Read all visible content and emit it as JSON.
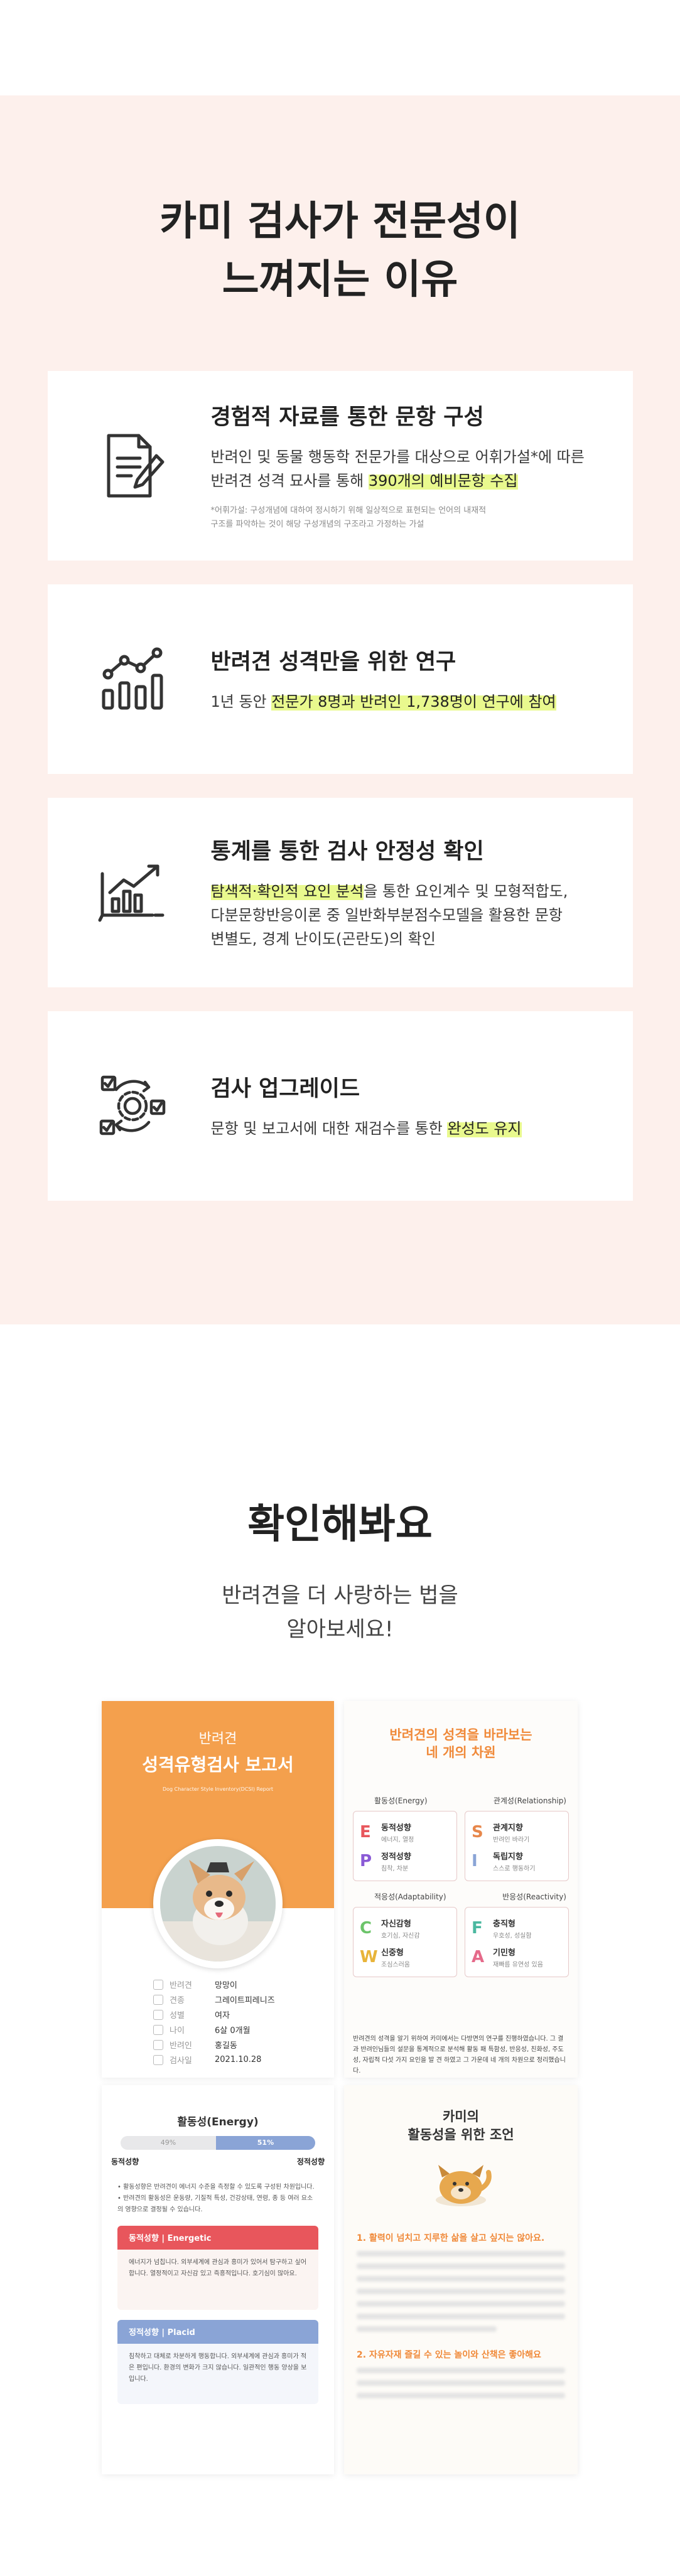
{
  "why": {
    "title_line1": "카미 검사가 전문성이",
    "title_line2": "느껴지는 이유",
    "cards": [
      {
        "icon": "document-pen-icon",
        "title": "경험적 자료를 통한 문항 구성",
        "desc_line1": "반려인 및 동물 행동학 전문가를 대상으로 어휘가설*에 따른",
        "desc_line2_pre": "반려견 성격 묘사를 통해 ",
        "desc_line2_hl": "390개의 예비문항 수집",
        "note_line1": "*어휘가설: 구성개념에 대하여 정시하기 위해 일상적으로 표현되는 언어의 내재적",
        "note_line2": "구조를 파악하는 것이 해당 구성개념의 구조라고 가정하는 가설"
      },
      {
        "icon": "chart-research-icon",
        "title": "반려견 성격만을 위한 연구",
        "desc_pre": "1년 동안 ",
        "desc_hl": "전문가 8명과 반려인 1,738명이 연구에 참여"
      },
      {
        "icon": "statistics-screen-icon",
        "title": "통계를 통한 검사 안정성 확인",
        "desc_hl": "탐색적·확인적 요인 분석",
        "desc_line1_post": "을 통한 요인계수 및 모형적합도,",
        "desc_line2": "다분문항반응이론 중 일반화부분점수모델을 활용한 문항",
        "desc_line3": "변별도, 경계 난이도(곤란도)의 확인"
      },
      {
        "icon": "upgrade-gear-icon",
        "title": "검사 업그레이드",
        "desc_pre": "문항 및 보고서에 대한 재검수를 통한 ",
        "desc_hl": "완성도 유지"
      }
    ]
  },
  "check": {
    "title": "확인해봐요",
    "sub_line1": "반려견을 더 사랑하는 법을",
    "sub_line2": "알아보세요!"
  },
  "report_cover": {
    "small": "반려견",
    "big": "성격유형검사 보고서",
    "eng": "Dog Character Style Inventory(DCSI) Report",
    "info": [
      {
        "key": "반려견",
        "val": "망망이"
      },
      {
        "key": "견종",
        "val": "그레이트피레니즈"
      },
      {
        "key": "성별",
        "val": "여자"
      },
      {
        "key": "나이",
        "val": "6살 0개월"
      },
      {
        "key": "반려인",
        "val": "홍길동"
      },
      {
        "key": "검사일",
        "val": "2021.10.28"
      }
    ]
  },
  "axes_panel": {
    "title_line1": "반려견의 성격을 바라보는",
    "title_line2": "네 개의 차원",
    "row1_left": "활동성(Energy)",
    "row1_right": "관계성(Relationship)",
    "row2_left": "적응성(Adaptability)",
    "row2_right": "반응성(Reactivity)",
    "boxes": [
      [
        {
          "letter": "E",
          "color": "#e8565c",
          "name": "동적성향",
          "sub": "에너지, 열정"
        },
        {
          "letter": "P",
          "color": "#8a5ad6",
          "name": "정적성향",
          "sub": "침착, 차분"
        }
      ],
      [
        {
          "letter": "S",
          "color": "#e7874b",
          "name": "관계지향",
          "sub": "반려인 바라기"
        },
        {
          "letter": "I",
          "color": "#8aa4d6",
          "name": "독립지향",
          "sub": "스스로 행동하기"
        }
      ],
      [
        {
          "letter": "C",
          "color": "#6cc46a",
          "name": "자신감형",
          "sub": "호기심, 자신감"
        },
        {
          "letter": "W",
          "color": "#e8b43a",
          "name": "신중형",
          "sub": "조심스러움"
        }
      ],
      [
        {
          "letter": "F",
          "color": "#4ab8a0",
          "name": "충직형",
          "sub": "우호성, 성실함"
        },
        {
          "letter": "A",
          "color": "#e56a8a",
          "name": "기민형",
          "sub": "재빠름 유연성 있음"
        }
      ]
    ],
    "text": "반려견의 성격을 알기 위하여 카미에서는 다방면의 연구를 진행하였습니다. 그 결과 반려인님들의 설문을 통계적으로 분석해 활동 패 특함성, 반응성, 친화성, 주도성, 자립적 다섯 가지 요인을 발 견 하였고 그 가운데 네 개의 차원으로 정리했습니다."
  },
  "energy_panel": {
    "title": "활동성(Energy)",
    "bar_left": "49%",
    "bar_right": "51%",
    "bar_right_pct": 51,
    "end_left": "동적성향",
    "end_right": "정적성향",
    "list_1": "활동성향은 반려견이 에너지 수준을 측정할 수 있도록 구성된 차원입니다.",
    "list_2": "반려견의 활동성은 운동량, 기질적 특성, 건강상태, 연령, 종 등 여러 요소의 영향으로 결정될 수 있습니다.",
    "box1_head": "동적성향 | Energetic",
    "box1_color": "#e8565c",
    "box1_body": "에너지가 넘칩니다. 외부세계에 관심과 흥미가 있어서 탐구하고 싶어합니다. 열정적이고 자신감 있고 즉흥적입니다. 호기심이 많아요.",
    "box2_head": "정적성향 | Placid",
    "box2_color": "#8aa4d6",
    "box2_body": "침착하고 대체로 차분하게 행동합니다. 외부세계에 관심과 흥미가 적은 편입니다. 환경의 변화가 크지 않습니다. 일관적인 행동 양상을 보입니다."
  },
  "advice_panel": {
    "title_line1": "카미의",
    "title_line2": "활동성을 위한 조언",
    "h1": "1. 활력이 넘치고 지루한 삶을 살고 싶지는 않아요.",
    "h2": "2. 자유자재 즐길 수 있는 놀이와 산책은 좋아해요"
  }
}
